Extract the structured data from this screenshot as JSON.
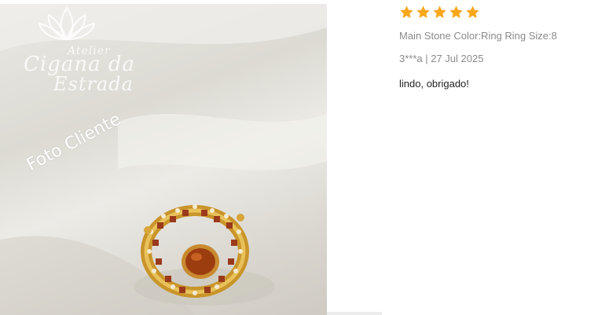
{
  "photo": {
    "watermark_line1": "Atelier",
    "watermark_line2": "Cigana da",
    "watermark_line3": "Estrada",
    "overlay_label": "Foto Cliente",
    "icon": "lotus-logo-icon"
  },
  "review": {
    "rating": 5,
    "rating_max": 5,
    "star_color": "#f7a81b",
    "sku": "Main Stone Color:Ring Ring Size:8",
    "author_date": "3***a | 27 Jul 2025",
    "comment": "lindo, obrigado!"
  }
}
